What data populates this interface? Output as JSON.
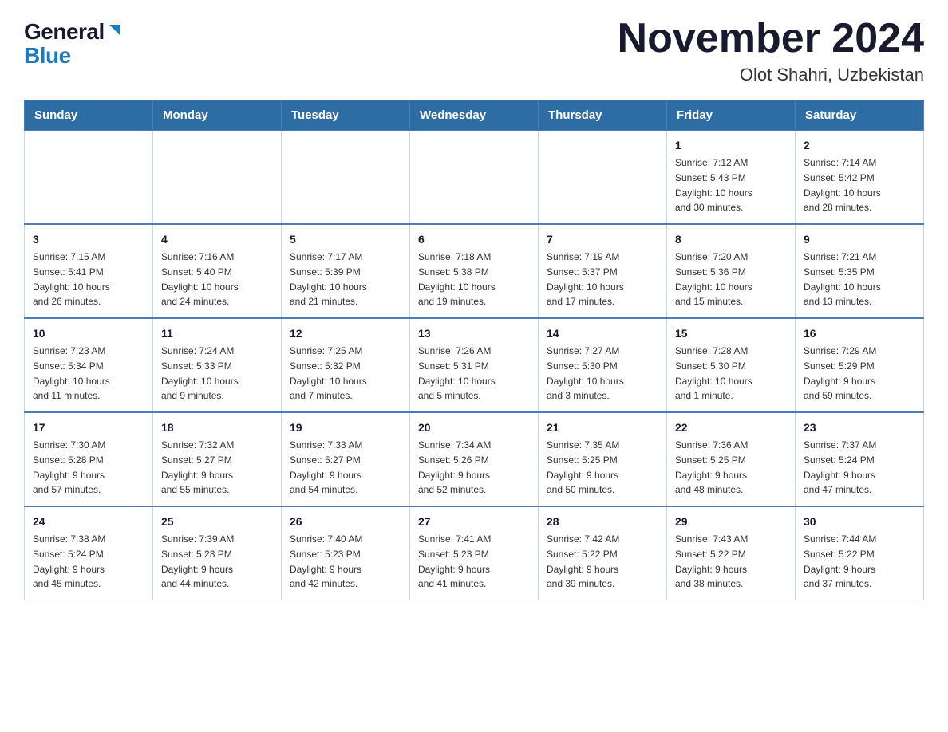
{
  "header": {
    "logo_general": "General",
    "logo_blue": "Blue",
    "title": "November 2024",
    "subtitle": "Olot Shahri, Uzbekistan"
  },
  "days_of_week": [
    "Sunday",
    "Monday",
    "Tuesday",
    "Wednesday",
    "Thursday",
    "Friday",
    "Saturday"
  ],
  "weeks": [
    [
      {
        "day": "",
        "info": ""
      },
      {
        "day": "",
        "info": ""
      },
      {
        "day": "",
        "info": ""
      },
      {
        "day": "",
        "info": ""
      },
      {
        "day": "",
        "info": ""
      },
      {
        "day": "1",
        "info": "Sunrise: 7:12 AM\nSunset: 5:43 PM\nDaylight: 10 hours\nand 30 minutes."
      },
      {
        "day": "2",
        "info": "Sunrise: 7:14 AM\nSunset: 5:42 PM\nDaylight: 10 hours\nand 28 minutes."
      }
    ],
    [
      {
        "day": "3",
        "info": "Sunrise: 7:15 AM\nSunset: 5:41 PM\nDaylight: 10 hours\nand 26 minutes."
      },
      {
        "day": "4",
        "info": "Sunrise: 7:16 AM\nSunset: 5:40 PM\nDaylight: 10 hours\nand 24 minutes."
      },
      {
        "day": "5",
        "info": "Sunrise: 7:17 AM\nSunset: 5:39 PM\nDaylight: 10 hours\nand 21 minutes."
      },
      {
        "day": "6",
        "info": "Sunrise: 7:18 AM\nSunset: 5:38 PM\nDaylight: 10 hours\nand 19 minutes."
      },
      {
        "day": "7",
        "info": "Sunrise: 7:19 AM\nSunset: 5:37 PM\nDaylight: 10 hours\nand 17 minutes."
      },
      {
        "day": "8",
        "info": "Sunrise: 7:20 AM\nSunset: 5:36 PM\nDaylight: 10 hours\nand 15 minutes."
      },
      {
        "day": "9",
        "info": "Sunrise: 7:21 AM\nSunset: 5:35 PM\nDaylight: 10 hours\nand 13 minutes."
      }
    ],
    [
      {
        "day": "10",
        "info": "Sunrise: 7:23 AM\nSunset: 5:34 PM\nDaylight: 10 hours\nand 11 minutes."
      },
      {
        "day": "11",
        "info": "Sunrise: 7:24 AM\nSunset: 5:33 PM\nDaylight: 10 hours\nand 9 minutes."
      },
      {
        "day": "12",
        "info": "Sunrise: 7:25 AM\nSunset: 5:32 PM\nDaylight: 10 hours\nand 7 minutes."
      },
      {
        "day": "13",
        "info": "Sunrise: 7:26 AM\nSunset: 5:31 PM\nDaylight: 10 hours\nand 5 minutes."
      },
      {
        "day": "14",
        "info": "Sunrise: 7:27 AM\nSunset: 5:30 PM\nDaylight: 10 hours\nand 3 minutes."
      },
      {
        "day": "15",
        "info": "Sunrise: 7:28 AM\nSunset: 5:30 PM\nDaylight: 10 hours\nand 1 minute."
      },
      {
        "day": "16",
        "info": "Sunrise: 7:29 AM\nSunset: 5:29 PM\nDaylight: 9 hours\nand 59 minutes."
      }
    ],
    [
      {
        "day": "17",
        "info": "Sunrise: 7:30 AM\nSunset: 5:28 PM\nDaylight: 9 hours\nand 57 minutes."
      },
      {
        "day": "18",
        "info": "Sunrise: 7:32 AM\nSunset: 5:27 PM\nDaylight: 9 hours\nand 55 minutes."
      },
      {
        "day": "19",
        "info": "Sunrise: 7:33 AM\nSunset: 5:27 PM\nDaylight: 9 hours\nand 54 minutes."
      },
      {
        "day": "20",
        "info": "Sunrise: 7:34 AM\nSunset: 5:26 PM\nDaylight: 9 hours\nand 52 minutes."
      },
      {
        "day": "21",
        "info": "Sunrise: 7:35 AM\nSunset: 5:25 PM\nDaylight: 9 hours\nand 50 minutes."
      },
      {
        "day": "22",
        "info": "Sunrise: 7:36 AM\nSunset: 5:25 PM\nDaylight: 9 hours\nand 48 minutes."
      },
      {
        "day": "23",
        "info": "Sunrise: 7:37 AM\nSunset: 5:24 PM\nDaylight: 9 hours\nand 47 minutes."
      }
    ],
    [
      {
        "day": "24",
        "info": "Sunrise: 7:38 AM\nSunset: 5:24 PM\nDaylight: 9 hours\nand 45 minutes."
      },
      {
        "day": "25",
        "info": "Sunrise: 7:39 AM\nSunset: 5:23 PM\nDaylight: 9 hours\nand 44 minutes."
      },
      {
        "day": "26",
        "info": "Sunrise: 7:40 AM\nSunset: 5:23 PM\nDaylight: 9 hours\nand 42 minutes."
      },
      {
        "day": "27",
        "info": "Sunrise: 7:41 AM\nSunset: 5:23 PM\nDaylight: 9 hours\nand 41 minutes."
      },
      {
        "day": "28",
        "info": "Sunrise: 7:42 AM\nSunset: 5:22 PM\nDaylight: 9 hours\nand 39 minutes."
      },
      {
        "day": "29",
        "info": "Sunrise: 7:43 AM\nSunset: 5:22 PM\nDaylight: 9 hours\nand 38 minutes."
      },
      {
        "day": "30",
        "info": "Sunrise: 7:44 AM\nSunset: 5:22 PM\nDaylight: 9 hours\nand 37 minutes."
      }
    ]
  ]
}
